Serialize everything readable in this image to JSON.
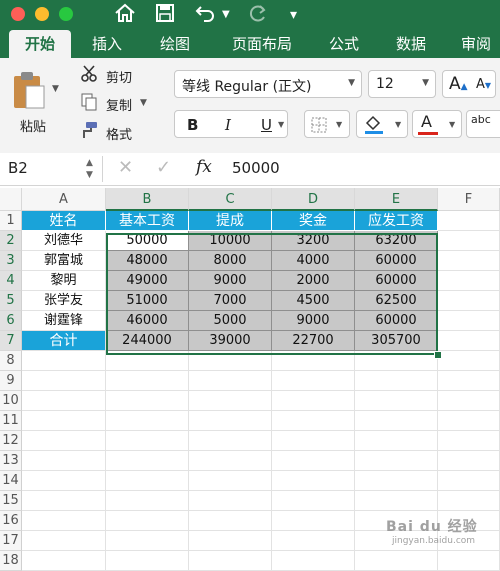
{
  "colors": {
    "accent": "#217346",
    "header_fill": "#1aa3d9",
    "selection_fill": "#c8c8c8"
  },
  "ribbon_tabs": [
    "开始",
    "插入",
    "绘图",
    "页面布局",
    "公式",
    "数据",
    "审阅"
  ],
  "clipboard": {
    "paste": "粘贴",
    "cut": "剪切",
    "copy": "复制",
    "format_painter": "格式"
  },
  "font": {
    "name": "等线 Regular (正文)",
    "size": "12",
    "increase": "A",
    "decrease": "A",
    "bold": "B",
    "italic": "I",
    "underline": "U",
    "font_color": "A",
    "wrap": "abc"
  },
  "formula_bar": {
    "name_box": "B2",
    "fx": "fx",
    "value": "50000"
  },
  "columns": [
    "A",
    "B",
    "C",
    "D",
    "E",
    "F"
  ],
  "rows": [
    "1",
    "2",
    "3",
    "4",
    "5",
    "6",
    "7",
    "8",
    "9",
    "10",
    "11",
    "12",
    "13",
    "14",
    "15",
    "16",
    "17",
    "18"
  ],
  "table": {
    "headers": [
      "姓名",
      "基本工资",
      "提成",
      "奖金",
      "应发工资"
    ],
    "rows": [
      [
        "刘德华",
        "50000",
        "10000",
        "3200",
        "63200"
      ],
      [
        "郭富城",
        "48000",
        "8000",
        "4000",
        "60000"
      ],
      [
        "黎明",
        "49000",
        "9000",
        "2000",
        "60000"
      ],
      [
        "张学友",
        "51000",
        "7000",
        "4500",
        "62500"
      ],
      [
        "谢霆锋",
        "46000",
        "5000",
        "9000",
        "60000"
      ],
      [
        "合计",
        "244000",
        "39000",
        "22700",
        "305700"
      ]
    ]
  },
  "watermark": {
    "line1": "Bai du 经验",
    "line2": "jingyan.baidu.com"
  }
}
